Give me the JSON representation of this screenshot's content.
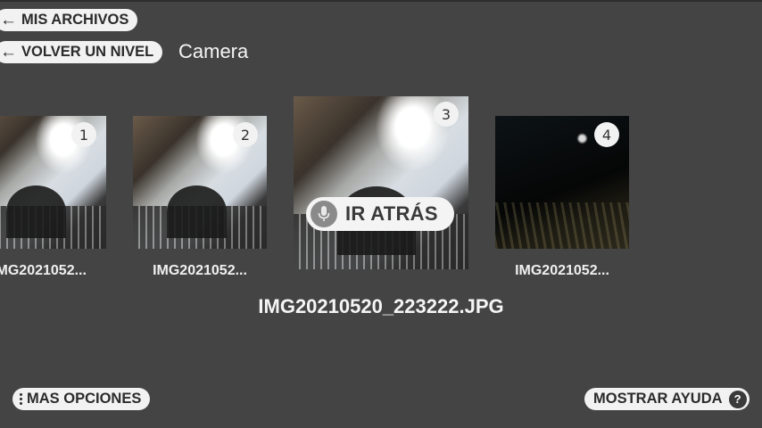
{
  "nav": {
    "back_to_files_label": "MIS ARCHIVOS",
    "up_one_level_label": "VOLVER UN NIVEL",
    "folder_name": "Camera"
  },
  "gallery": {
    "items": [
      {
        "index": "1",
        "caption": "IMG2021052..."
      },
      {
        "index": "2",
        "caption": "IMG2021052..."
      },
      {
        "index": "3",
        "caption": ""
      },
      {
        "index": "4",
        "caption": "IMG2021052..."
      }
    ],
    "selected_index": 3
  },
  "voice_command": {
    "label": "IR ATRÁS",
    "icon": "microphone-icon"
  },
  "selected_filename": "IMG20210520_223222.JPG",
  "footer": {
    "more_options_label": "MAS OPCIONES",
    "show_help_label": "MOSTRAR AYUDA",
    "help_icon_text": "?"
  },
  "colors": {
    "background": "#444444",
    "pill_background": "#f2f2f2",
    "pill_text": "#2b2b2b"
  }
}
